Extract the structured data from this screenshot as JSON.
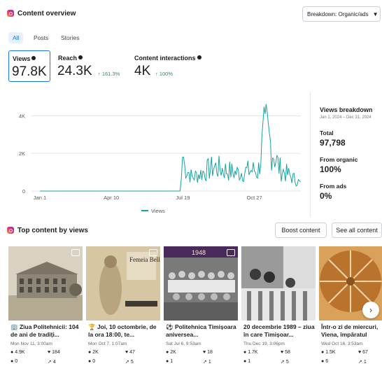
{
  "header": {
    "title": "Content overview",
    "breakdown_label": "Breakdown: Organic/ads"
  },
  "tabs": [
    {
      "label": "All"
    },
    {
      "label": "Posts"
    },
    {
      "label": "Stories"
    }
  ],
  "metrics": [
    {
      "label": "Views",
      "value": "97.8K",
      "change": ""
    },
    {
      "label": "Reach",
      "value": "24.3K",
      "change": "↑ 161.3%"
    },
    {
      "label": "Content interactions",
      "value": "4K",
      "change": "↑ 100%"
    }
  ],
  "chart_data": {
    "type": "line",
    "series": [
      {
        "name": "Views",
        "color": "#14a3a3"
      }
    ],
    "y_ticks": [
      "4K",
      "2K",
      "0"
    ],
    "x_ticks": [
      "Jan 1",
      "Apr 10",
      "Jul 19",
      "Oct 27"
    ],
    "ylim": [
      0,
      4500
    ],
    "x": [
      "Jan 1",
      "Jul 15",
      "Jul 19",
      "Aug 1",
      "Sep 1",
      "Oct 1",
      "Oct 27",
      "Nov 1",
      "Nov 11",
      "Dec 1",
      "Dec 31"
    ],
    "values": [
      0,
      0,
      1800,
      900,
      1600,
      1200,
      1400,
      1200,
      4100,
      1500,
      500
    ]
  },
  "breakdown": {
    "title": "Views breakdown",
    "date_range": "Jan 1, 2024 – Dec 31, 2024",
    "total_label": "Total",
    "total_value": "97,798",
    "organic_label": "From organic",
    "organic_value": "100%",
    "ads_label": "From ads",
    "ads_value": "0%"
  },
  "top_content": {
    "title": "Top content by views",
    "boost_label": "Boost content",
    "see_all_label": "See all content",
    "cards": [
      {
        "title": "🏢 Ziua Politehnicii: 104 de ani de tradiți...",
        "date": "Mon Nov 11, 3:00am",
        "views": "4.9K",
        "likes": "184",
        "comments": "0",
        "shares": "4"
      },
      {
        "title": "🏆 Joi, 10 octombrie, de la ora 18:00, te...",
        "date": "Mon Oct 7, 1:07am",
        "views": "2K",
        "likes": "47",
        "comments": "0",
        "shares": "5"
      },
      {
        "title": "⚽ Politehnica Timișoara aniversea...",
        "date": "Sat Jul 6, 9:53am",
        "views": "2K",
        "likes": "18",
        "comments": "1",
        "shares": "1"
      },
      {
        "title": "20 decembrie 1989 – ziua în care Timișoar...",
        "date": "Thu Dec 19, 3:06pm",
        "views": "1.7K",
        "likes": "58",
        "comments": "1",
        "shares": "5"
      },
      {
        "title": "Într-o zi de miercuri, Viena, împăratul Fra...",
        "date": "Wed Oct 16, 3:53am",
        "views": "1.5K",
        "likes": "67",
        "comments": "6",
        "shares": "1"
      }
    ],
    "card2_poster_title": "Femeia Belle",
    "card3_year": "1948"
  }
}
